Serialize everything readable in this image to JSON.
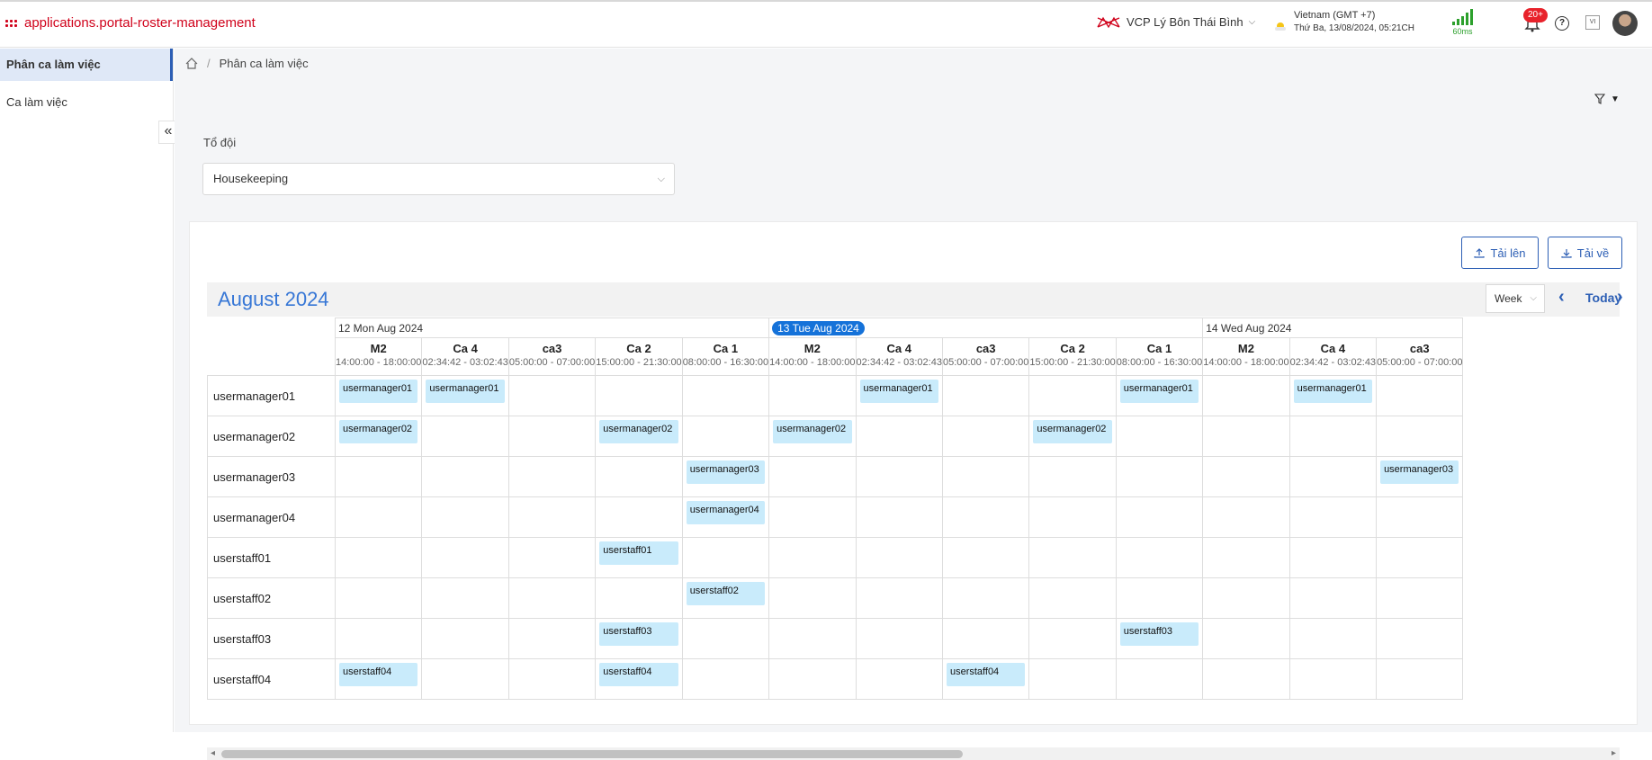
{
  "app": {
    "title": "applications.portal-roster-management"
  },
  "header": {
    "org": "VCP Lý Bôn Thái Bình",
    "timezone": "Vietnam (GMT +7)",
    "datetime": "Thứ Ba, 13/08/2024, 05:21CH",
    "latency": "60ms",
    "notifications": "20+",
    "lang": "VI"
  },
  "sidebar": {
    "items": [
      {
        "label": "Phân ca làm việc"
      },
      {
        "label": "Ca làm việc"
      }
    ]
  },
  "breadcrumb": {
    "current": "Phân ca làm việc"
  },
  "filter": {
    "label": "Tổ đội",
    "value": "Housekeeping"
  },
  "actions": {
    "upload": "Tải lên",
    "download": "Tải về"
  },
  "calendar": {
    "month": "August 2024",
    "view": "Week",
    "today": "Today",
    "days": [
      {
        "label": "12 Mon Aug 2024",
        "today": false
      },
      {
        "label": "13 Tue Aug 2024",
        "today": true
      },
      {
        "label": "14 Wed Aug 2024",
        "today": false
      }
    ],
    "shifts": [
      {
        "name": "M2",
        "time": "14:00:00 - 18:00:00"
      },
      {
        "name": "Ca 4",
        "time": "02:34:42 - 03:02:43"
      },
      {
        "name": "ca3",
        "time": "05:00:00 - 07:00:00"
      },
      {
        "name": "Ca 2",
        "time": "15:00:00 - 21:30:00"
      },
      {
        "name": "Ca 1",
        "time": "08:00:00 - 16:30:00"
      },
      {
        "name": "M2",
        "time": "14:00:00 - 18:00:00"
      },
      {
        "name": "Ca 4",
        "time": "02:34:42 - 03:02:43"
      },
      {
        "name": "ca3",
        "time": "05:00:00 - 07:00:00"
      },
      {
        "name": "Ca 2",
        "time": "15:00:00 - 21:30:00"
      },
      {
        "name": "Ca 1",
        "time": "08:00:00 - 16:30:00"
      },
      {
        "name": "M2",
        "time": "14:00:00 - 18:00:00"
      },
      {
        "name": "Ca 4",
        "time": "02:34:42 - 03:02:43"
      },
      {
        "name": "ca3",
        "time": "05:00:00 - 07:00:00"
      }
    ],
    "rows": [
      {
        "name": "usermanager01",
        "slots": [
          0,
          1,
          6,
          9,
          11
        ]
      },
      {
        "name": "usermanager02",
        "slots": [
          0,
          3,
          5,
          8
        ]
      },
      {
        "name": "usermanager03",
        "slots": [
          4,
          12
        ]
      },
      {
        "name": "usermanager04",
        "slots": [
          4
        ]
      },
      {
        "name": "userstaff01",
        "slots": [
          3
        ]
      },
      {
        "name": "userstaff02",
        "slots": [
          4
        ]
      },
      {
        "name": "userstaff03",
        "slots": [
          3,
          9
        ]
      },
      {
        "name": "userstaff04",
        "slots": [
          0,
          3,
          7
        ]
      }
    ]
  }
}
